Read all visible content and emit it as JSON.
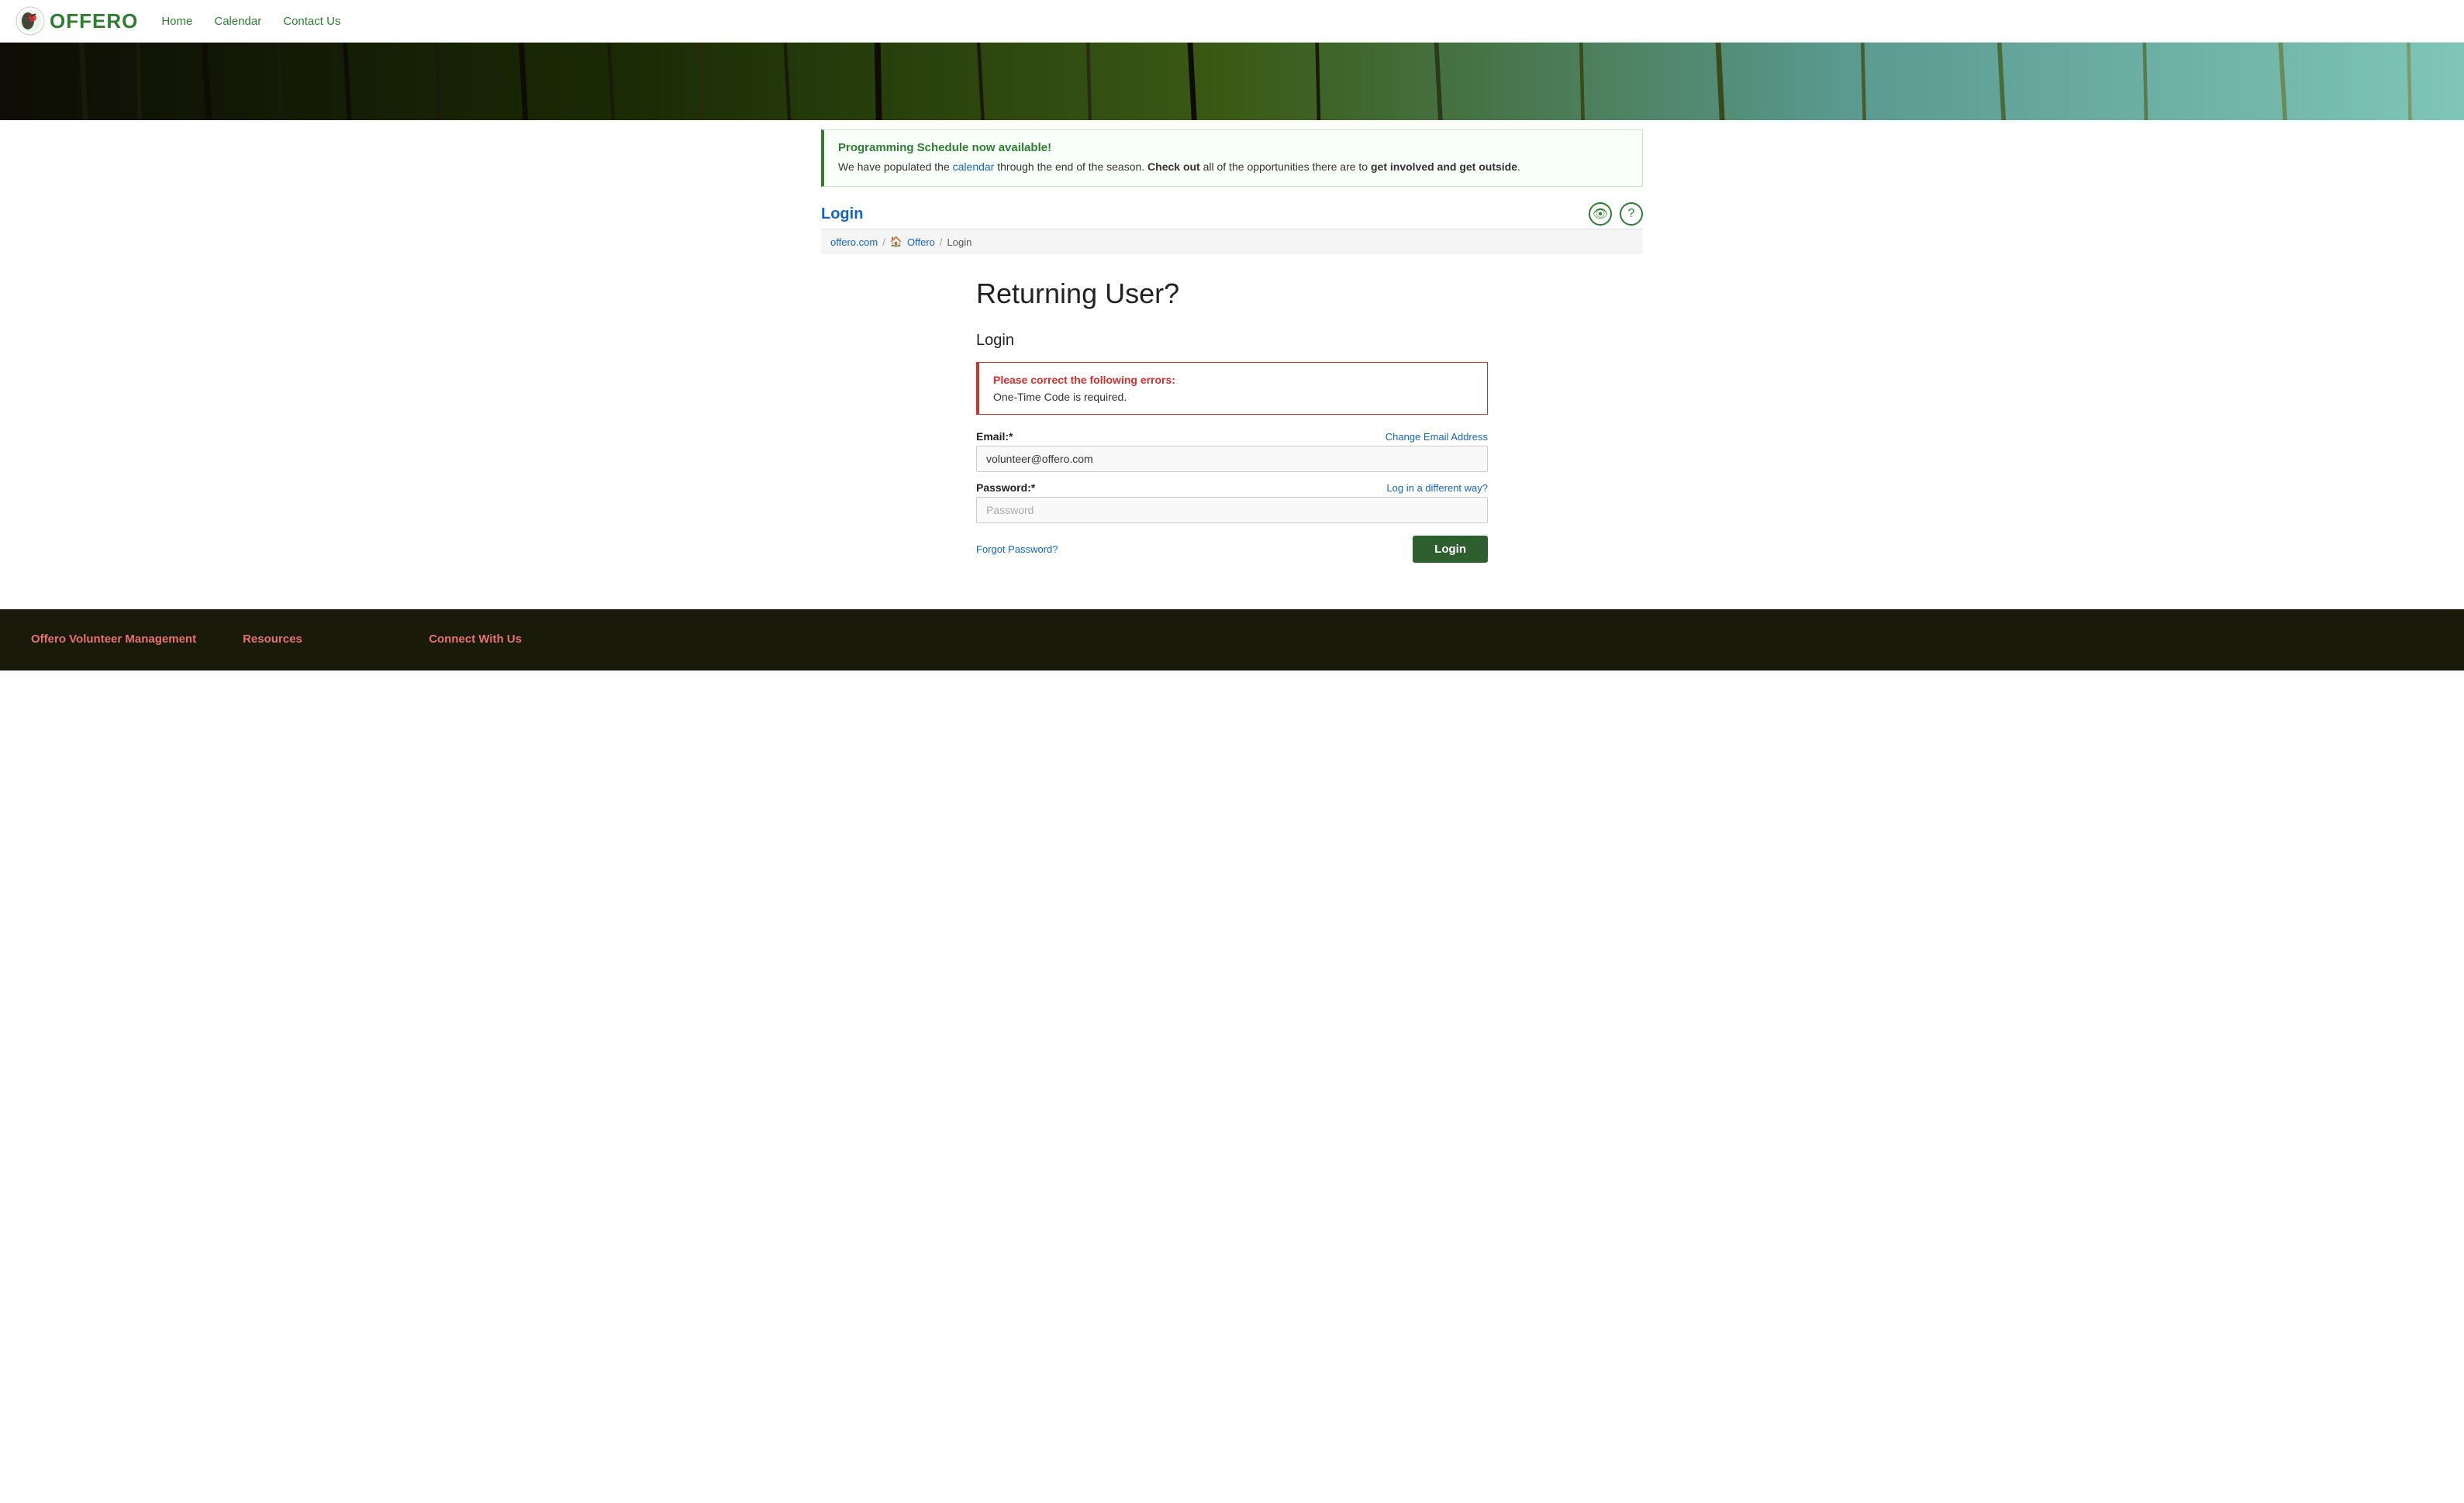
{
  "header": {
    "logo_text": "OFFERO",
    "nav": {
      "home": "Home",
      "calendar": "Calendar",
      "contact_us": "Contact Us"
    }
  },
  "alert": {
    "title": "Programming Schedule now available!",
    "body_prefix": "We have populated the ",
    "calendar_link": "calendar",
    "body_middle": " through the end of the season. ",
    "check_out": "Check out",
    "body_suffix": " all of the opportunities there are to ",
    "bold_end": "get involved and get outside",
    "period": "."
  },
  "page": {
    "title": "Login",
    "breadcrumb": {
      "site": "offero.com",
      "home": "Offero",
      "current": "Login"
    }
  },
  "icons": {
    "eye": "👁",
    "help": "?"
  },
  "form": {
    "returning_title": "Returning User?",
    "login_subtitle": "Login",
    "error": {
      "title": "Please correct the following errors:",
      "message": "One-Time Code is required."
    },
    "email_label": "Email:*",
    "email_value": "volunteer@offero.com",
    "change_email_link": "Change Email Address",
    "password_label": "Password:*",
    "password_placeholder": "Password",
    "log_in_different_link": "Log in a different way?",
    "forgot_password_link": "Forgot Password?",
    "login_button": "Login"
  },
  "footer": {
    "col1_title": "Offero Volunteer Management",
    "col2_title": "Resources",
    "col3_title": "Connect With Us"
  }
}
